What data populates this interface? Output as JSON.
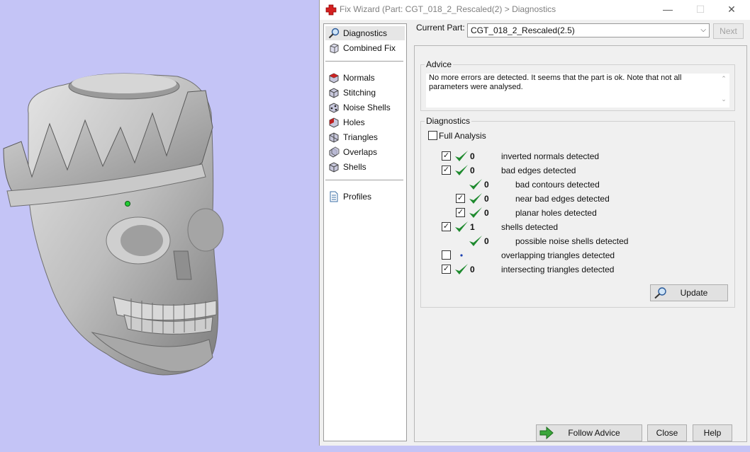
{
  "window": {
    "title": "Fix Wizard (Part: CGT_018_2_Rescaled(2) > Diagnostics",
    "min_glyph": "—",
    "max_glyph": "☐",
    "close_glyph": "✕"
  },
  "sidebar": {
    "items": [
      {
        "label": "Diagnostics",
        "icon": "magnifier-icon",
        "selected": true
      },
      {
        "label": "Combined Fix",
        "icon": "cube-icon"
      },
      {
        "label": "Normals",
        "icon": "normals-icon"
      },
      {
        "label": "Stitching",
        "icon": "stitching-icon"
      },
      {
        "label": "Noise Shells",
        "icon": "noise-shells-icon"
      },
      {
        "label": "Holes",
        "icon": "holes-icon"
      },
      {
        "label": "Triangles",
        "icon": "triangles-icon"
      },
      {
        "label": "Overlaps",
        "icon": "overlaps-icon"
      },
      {
        "label": "Shells",
        "icon": "shells-icon"
      },
      {
        "label": "Profiles",
        "icon": "document-icon"
      }
    ]
  },
  "header": {
    "current_part_label": "Current Part:",
    "current_part_value": "CGT_018_2_Rescaled(2.5)",
    "next_label": "Next"
  },
  "advice": {
    "title": "Advice",
    "text": "No more errors are detected. It seems that the part is ok. Note that not all parameters were analysed."
  },
  "diagnostics": {
    "title": "Diagnostics",
    "full_analysis_label": "Full Analysis",
    "full_analysis_checked": false,
    "rows": [
      {
        "checked": true,
        "count": "0",
        "label": "inverted normals detected"
      },
      {
        "checked": true,
        "count": "0",
        "label": "bad edges detected"
      },
      {
        "checked": null,
        "count": "0",
        "label": "bad contours detected"
      },
      {
        "checked": true,
        "count": "0",
        "label": "near bad edges detected"
      },
      {
        "checked": true,
        "count": "0",
        "label": "planar holes detected"
      },
      {
        "checked": true,
        "count": "1",
        "label": "shells detected"
      },
      {
        "checked": null,
        "count": "0",
        "label": "possible noise shells detected"
      },
      {
        "checked": false,
        "count": "",
        "label": "overlapping triangles detected"
      },
      {
        "checked": true,
        "count": "0",
        "label": "intersecting triangles detected"
      }
    ],
    "update_label": "Update"
  },
  "footer": {
    "follow_advice_label": "Follow Advice",
    "close_label": "Close",
    "help_label": "Help"
  },
  "colors": {
    "viewport_bg": "#c4c4f6",
    "check_green": "#1e8a2e",
    "model_gray": "#b8b8b8"
  }
}
